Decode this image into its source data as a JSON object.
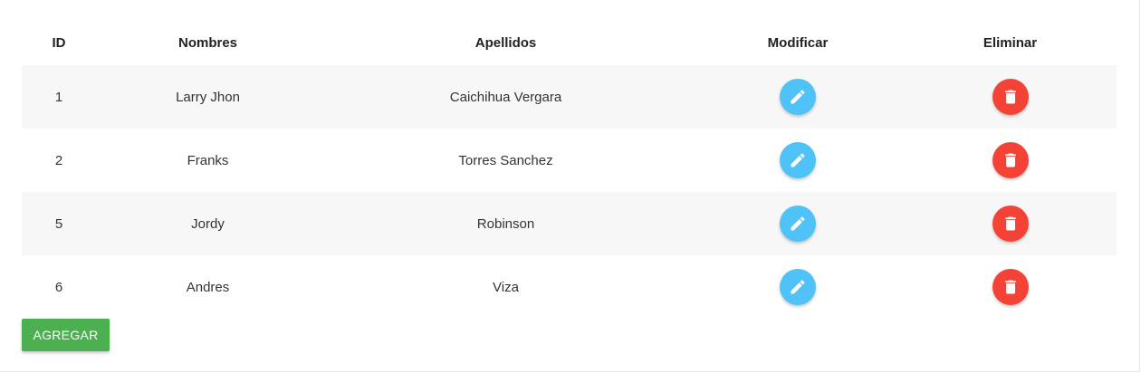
{
  "table": {
    "headers": {
      "id": "ID",
      "nombres": "Nombres",
      "apellidos": "Apellidos",
      "modificar": "Modificar",
      "eliminar": "Eliminar"
    },
    "rows": [
      {
        "id": "1",
        "nombres": "Larry Jhon",
        "apellidos": "Caichihua Vergara"
      },
      {
        "id": "2",
        "nombres": "Franks",
        "apellidos": "Torres Sanchez"
      },
      {
        "id": "5",
        "nombres": "Jordy",
        "apellidos": "Robinson"
      },
      {
        "id": "6",
        "nombres": "Andres",
        "apellidos": "Viza"
      }
    ],
    "edit_icon": "pencil-icon",
    "delete_icon": "trash-icon"
  },
  "actions": {
    "add_label": "AGREGAR"
  },
  "colors": {
    "edit_button": "#4fc3f7",
    "delete_button": "#f44336",
    "add_button": "#4caf50",
    "striped_row": "#f7f7f7"
  }
}
